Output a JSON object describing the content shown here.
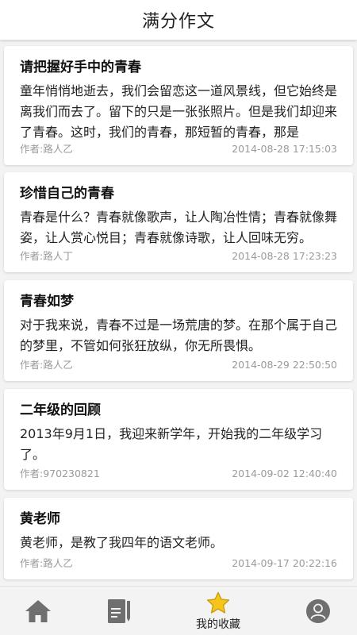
{
  "header": {
    "title": "满分作文"
  },
  "articles": [
    {
      "title": "请把握好手中的青春",
      "excerpt": "童年悄悄地逝去，我们会留恋这一道风景线，但它始终是离我们而去了。留下的只是一张张照片。但是我们却迎来了青春。这时，我们的青春，那短暂的青春，那是",
      "author": "作者:路人乙",
      "time": "2014-08-28 17:15:03"
    },
    {
      "title": "珍惜自己的青春",
      "excerpt": "青春是什么？青春就像歌声，让人陶冶性情；青春就像舞姿，让人赏心悦目；青春就像诗歌，让人回味无穷。",
      "author": "作者:路人丁",
      "time": "2014-08-28 17:23:23"
    },
    {
      "title": "青春如梦",
      "excerpt": "对于我来说，青春不过是一场荒唐的梦。在那个属于自己的梦里，不管如何张狂放纵，你无所畏惧。",
      "author": "作者:路人乙",
      "time": "2014-08-29 22:50:50"
    },
    {
      "title": "二年级的回顾",
      "excerpt": "2013年9月1日，我迎来新学年，开始我的二年级学习了。",
      "author": "作者:970230821",
      "time": "2014-09-02 12:40:40"
    },
    {
      "title": "黄老师",
      "excerpt": "黄老师，是教了我四年的语文老师。",
      "author": "作者:路人乙",
      "time": "2014-09-17 20:22:16"
    }
  ],
  "tabs": [
    {
      "icon": "home-icon",
      "label": ""
    },
    {
      "icon": "document-edit-icon",
      "label": ""
    },
    {
      "icon": "star-icon",
      "label": "我的收藏"
    },
    {
      "icon": "user-icon",
      "label": ""
    }
  ],
  "colors": {
    "background": "#f4f3f4",
    "card": "#ffffff",
    "meta_text": "#9a9a9a",
    "icon_gray": "#6f6f6f",
    "star_yellow": "#f5c51b"
  }
}
